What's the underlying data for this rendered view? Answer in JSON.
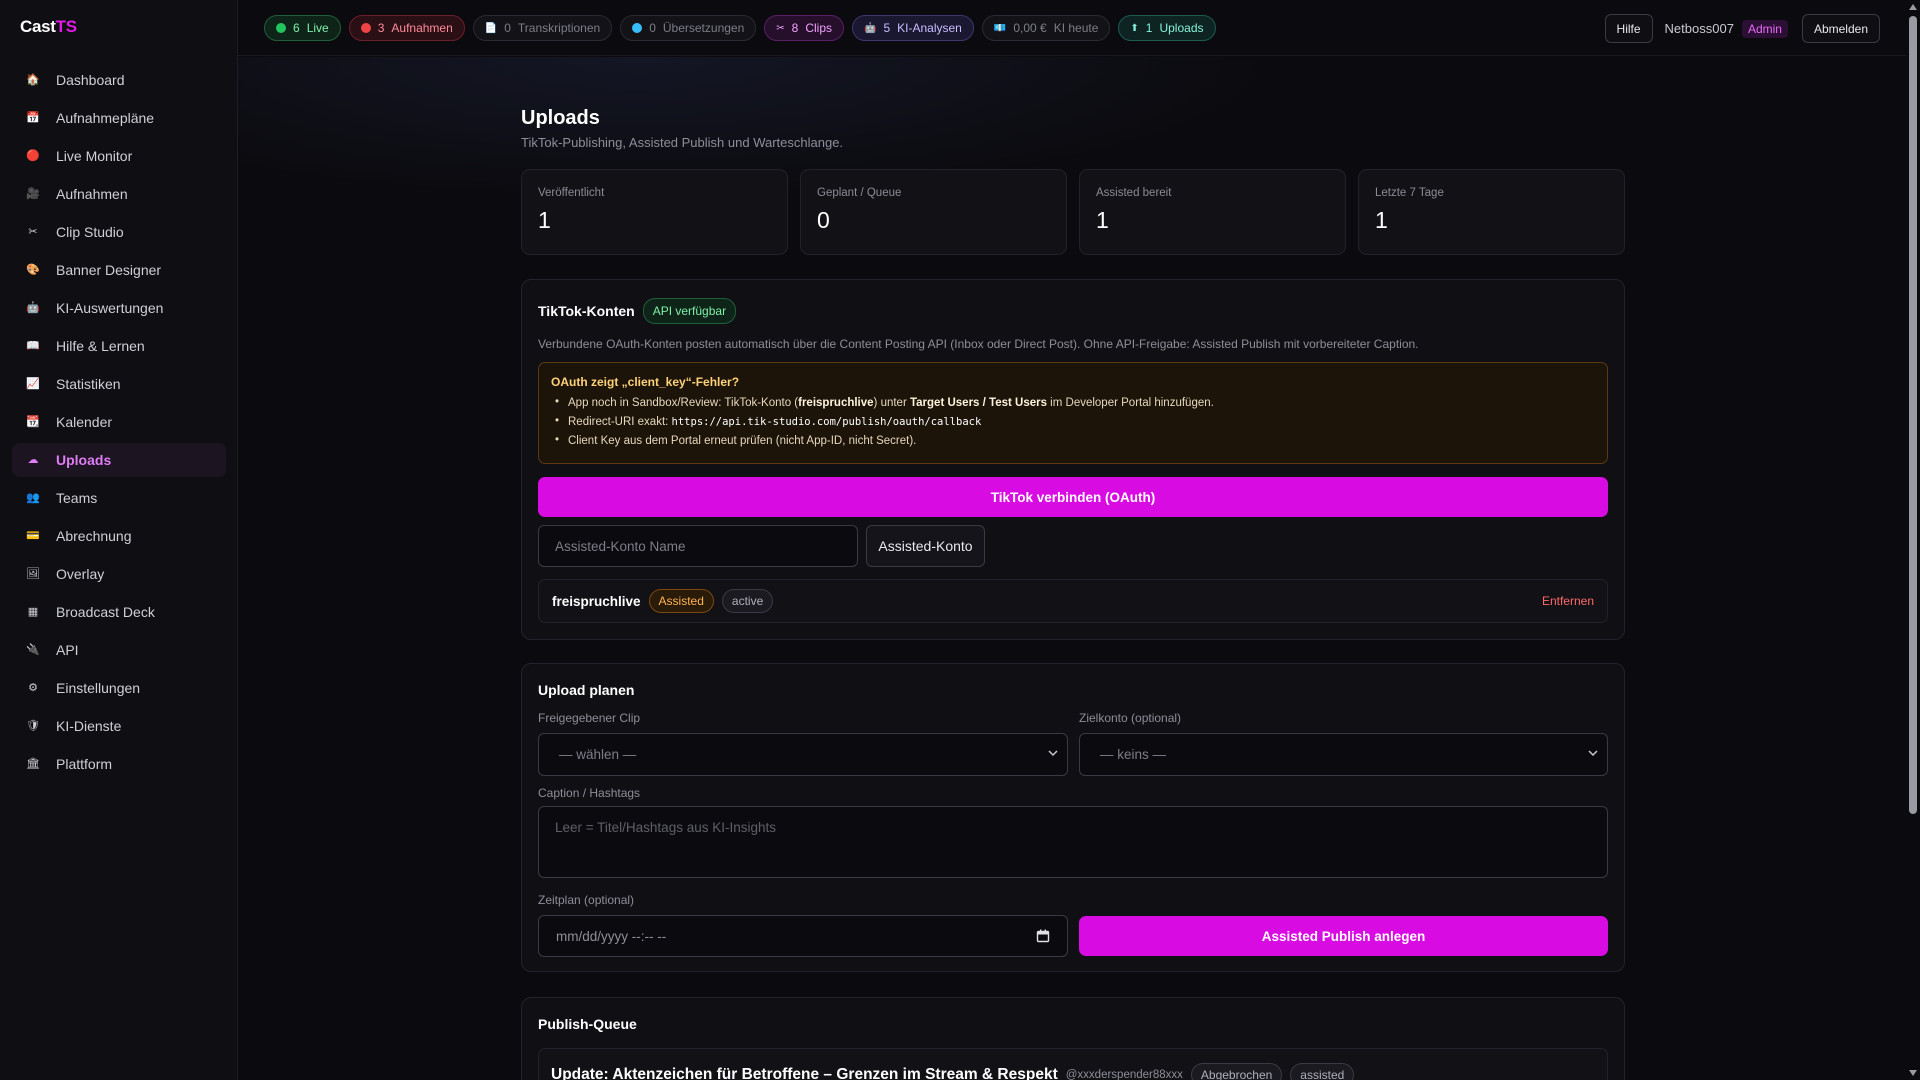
{
  "app": {
    "name_main": "Cast",
    "name_accent": "TS",
    "accent_color": "#d90be3"
  },
  "sidebar": {
    "items": [
      {
        "label": "Dashboard",
        "icon": "house-icon",
        "glyph": "🏠"
      },
      {
        "label": "Aufnahmepläne",
        "icon": "schedule-icon",
        "glyph": "📅"
      },
      {
        "label": "Live Monitor",
        "icon": "red-dot-icon",
        "glyph": "🔴"
      },
      {
        "label": "Aufnahmen",
        "icon": "recordings-icon",
        "glyph": "🎥"
      },
      {
        "label": "Clip Studio",
        "icon": "scissors-icon",
        "glyph": "✂"
      },
      {
        "label": "Banner Designer",
        "icon": "palette-icon",
        "glyph": "🎨"
      },
      {
        "label": "KI-Auswertungen",
        "icon": "robot-icon",
        "glyph": "🤖"
      },
      {
        "label": "Hilfe & Lernen",
        "icon": "book-icon",
        "glyph": "📖"
      },
      {
        "label": "Statistiken",
        "icon": "chart-icon",
        "glyph": "📈"
      },
      {
        "label": "Kalender",
        "icon": "calendar-icon",
        "glyph": "📆"
      },
      {
        "label": "Uploads",
        "icon": "cloud-icon",
        "glyph": "☁"
      },
      {
        "label": "Teams",
        "icon": "team-icon",
        "glyph": "👥"
      },
      {
        "label": "Abrechnung",
        "icon": "billing-icon",
        "glyph": "💳"
      },
      {
        "label": "Overlay",
        "icon": "overlay-icon",
        "glyph": "🖼"
      },
      {
        "label": "Broadcast Deck",
        "icon": "grid-icon",
        "glyph": "▦"
      },
      {
        "label": "API",
        "icon": "plug-icon",
        "glyph": "🔌"
      },
      {
        "label": "Einstellungen",
        "icon": "gear-icon",
        "glyph": "⚙"
      },
      {
        "label": "KI-Dienste",
        "icon": "shield-icon",
        "glyph": "🛡"
      },
      {
        "label": "Plattform",
        "icon": "bank-icon",
        "glyph": "🏛"
      }
    ],
    "active_label": "Uploads"
  },
  "topbar": {
    "pills": [
      {
        "num": "6",
        "label": "Live",
        "icon": "green-dot-icon"
      },
      {
        "num": "3",
        "label": "Aufnahmen",
        "icon": "red-dot-icon"
      },
      {
        "num": "0",
        "label": "Transkriptionen",
        "icon": "document-icon"
      },
      {
        "num": "0",
        "label": "Übersetzungen",
        "icon": "globe-icon"
      },
      {
        "num": "8",
        "label": "Clips",
        "icon": "scissors-icon"
      },
      {
        "num": "5",
        "label": "KI-Analysen",
        "icon": "robot-icon"
      },
      {
        "num": "0,00 €",
        "label": "KI heute",
        "icon": "money-icon"
      },
      {
        "num": "1",
        "label": "Uploads",
        "icon": "upload-icon"
      }
    ],
    "help_label": "Hilfe",
    "username": "Netboss007",
    "role_badge": "Admin",
    "logout_label": "Abmelden"
  },
  "page": {
    "title": "Uploads",
    "subtitle": "TikTok-Publishing, Assisted Publish und Warteschlange."
  },
  "stats": [
    {
      "label": "Veröffentlicht",
      "value": "1"
    },
    {
      "label": "Geplant / Queue",
      "value": "0"
    },
    {
      "label": "Assisted bereit",
      "value": "1"
    },
    {
      "label": "Letzte 7 Tage",
      "value": "1"
    }
  ],
  "tiktok": {
    "title": "TikTok-Konten",
    "api_badge": "API verfügbar",
    "description": "Verbundene OAuth-Konten posten automatisch über die Content Posting API (Inbox oder Direct Post). Ohne API-Freigabe: Assisted Publish mit vorbereiteter Caption.",
    "warning": {
      "title": "OAuth zeigt „client_key“-Fehler?",
      "line1_a": "App noch in Sandbox/Review: TikTok-Konto (",
      "line1_b": "freispruchlive",
      "line1_c": ") unter ",
      "line1_d": "Target Users / Test Users",
      "line1_e": " im Developer Portal hinzufügen.",
      "line2_a": "Redirect-URI exakt: ",
      "line2_code": "https://api.tik-studio.com/publish/oauth/callback",
      "line3": "Client Key aus dem Portal erneut prüfen (nicht App-ID, nicht Secret)."
    },
    "connect_button": "TikTok verbinden (OAuth)",
    "assisted_name_placeholder": "Assisted-Konto Name",
    "assisted_button": "Assisted-Konto",
    "account": {
      "name": "freispruchlive",
      "type_badge": "Assisted",
      "status_badge": "active",
      "remove_label": "Entfernen"
    }
  },
  "upload_plan": {
    "title": "Upload planen",
    "clip_label": "Freigegebener Clip",
    "clip_value": "— wählen —",
    "target_label": "Zielkonto (optional)",
    "target_value": "— keins —",
    "caption_label": "Caption / Hashtags",
    "caption_placeholder": "Leer = Titel/Hashtags aus KI-Insights",
    "schedule_label": "Zeitplan (optional)",
    "schedule_placeholder": "mm/dd/yyyy --:-- --",
    "publish_button": "Assisted Publish anlegen"
  },
  "publish_queue": {
    "title": "Publish-Queue",
    "items": [
      {
        "title": "Update: Aktenzeichen für Betroffene – Grenzen im Stream & Respekt",
        "user": "@xxxderspender88xxx",
        "status": "Abgebrochen",
        "mode": "assisted"
      }
    ]
  }
}
